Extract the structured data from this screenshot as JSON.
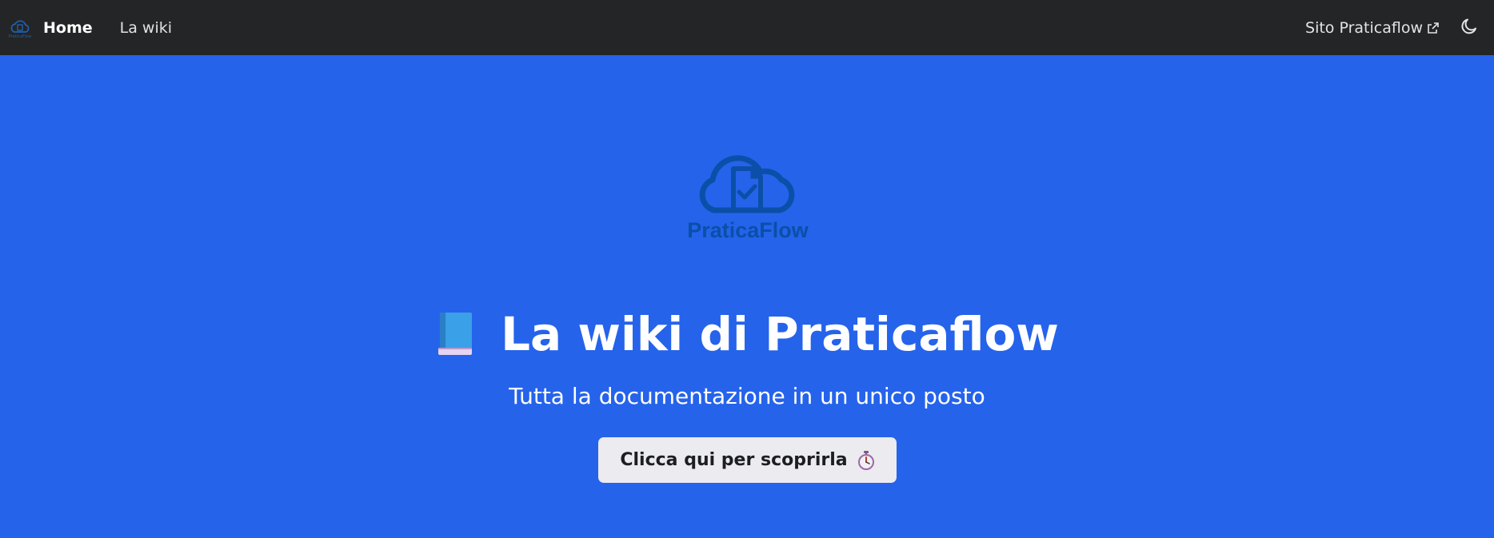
{
  "navbar": {
    "logo_icon": "praticaflow-logo-icon",
    "home_label": "Home",
    "wiki_label": "La wiki",
    "external_label": "Sito Praticaflow",
    "external_icon": "external-link-icon",
    "theme_icon": "moon-icon"
  },
  "hero": {
    "background_color": "#2563eb",
    "logo_text": "PraticaFlow",
    "title_icon": "book-icon",
    "title": "La wiki di Praticaflow",
    "subtitle": "Tutta la documentazione in un unico posto",
    "cta_label": "Clicca qui per scoprirla",
    "cta_icon": "stopwatch-icon"
  }
}
